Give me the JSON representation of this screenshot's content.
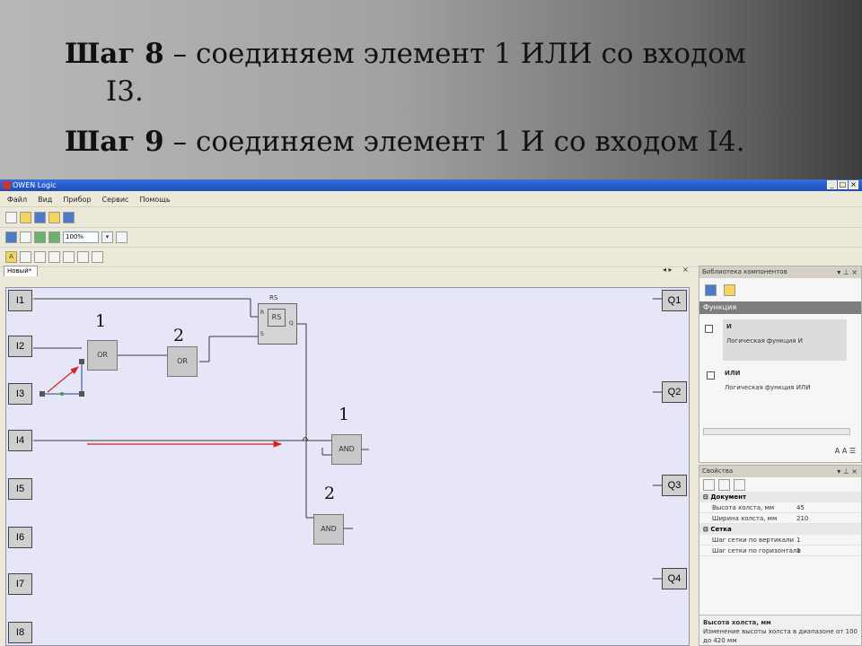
{
  "slide": {
    "step8_label": "Шаг 8",
    "step8_text": " – соединяем элемент 1 ИЛИ со входом",
    "step8_cont": "I3.",
    "step9_label": "Шаг 9",
    "step9_text": " – соединяем элемент 1 И со входом I4."
  },
  "window": {
    "title": "OWEN Logic",
    "min": "_",
    "max": "□",
    "close": "×"
  },
  "menu": [
    "Файл",
    "Вид",
    "Прибор",
    "Сервис",
    "Помощь"
  ],
  "toolbar": {
    "zoom": "100%"
  },
  "document": {
    "tab": "Новый*"
  },
  "canvas": {
    "inputs": [
      "I1",
      "I2",
      "I3",
      "I4",
      "I5",
      "I6",
      "I7",
      "I8"
    ],
    "outputs": [
      "Q1",
      "Q2",
      "Q3",
      "Q4"
    ],
    "blocks": {
      "or1": "OR",
      "or2": "OR",
      "and1": "AND",
      "and2": "AND",
      "rs_title": "RS",
      "rs_label": "RS",
      "rs_r": "R",
      "rs_s": "S",
      "rs_q": "Q"
    },
    "annotations": {
      "or1_num": "1",
      "or2_num": "2",
      "and1_num": "1",
      "and2_num": "2"
    }
  },
  "library": {
    "header": "Библиотека компонентов",
    "section": "Функция",
    "items": [
      {
        "name": "И",
        "desc": "Логическая функция И"
      },
      {
        "name": "ИЛИ",
        "desc": "Логическая функция ИЛИ"
      }
    ]
  },
  "properties": {
    "header": "Свойства",
    "cat_document": "Документ",
    "height_label": "Высота холста, мм",
    "height_value": "45",
    "width_label": "Ширина холста, мм",
    "width_value": "210",
    "cat_grid": "Сетка",
    "grid_v": "Шаг сетки по вертикали",
    "grid_v_value": "1",
    "grid_h": "Шаг сетки по горизонтали",
    "grid_h_value": "1",
    "desc_title": "Высота холста, мм",
    "desc_text": "Изменение высоты холста в диапазоне от 100 до 420 мм"
  },
  "colors": {
    "wire": "#3a3a3a",
    "arrow": "#d42020",
    "selection": "#5a7ab8"
  }
}
